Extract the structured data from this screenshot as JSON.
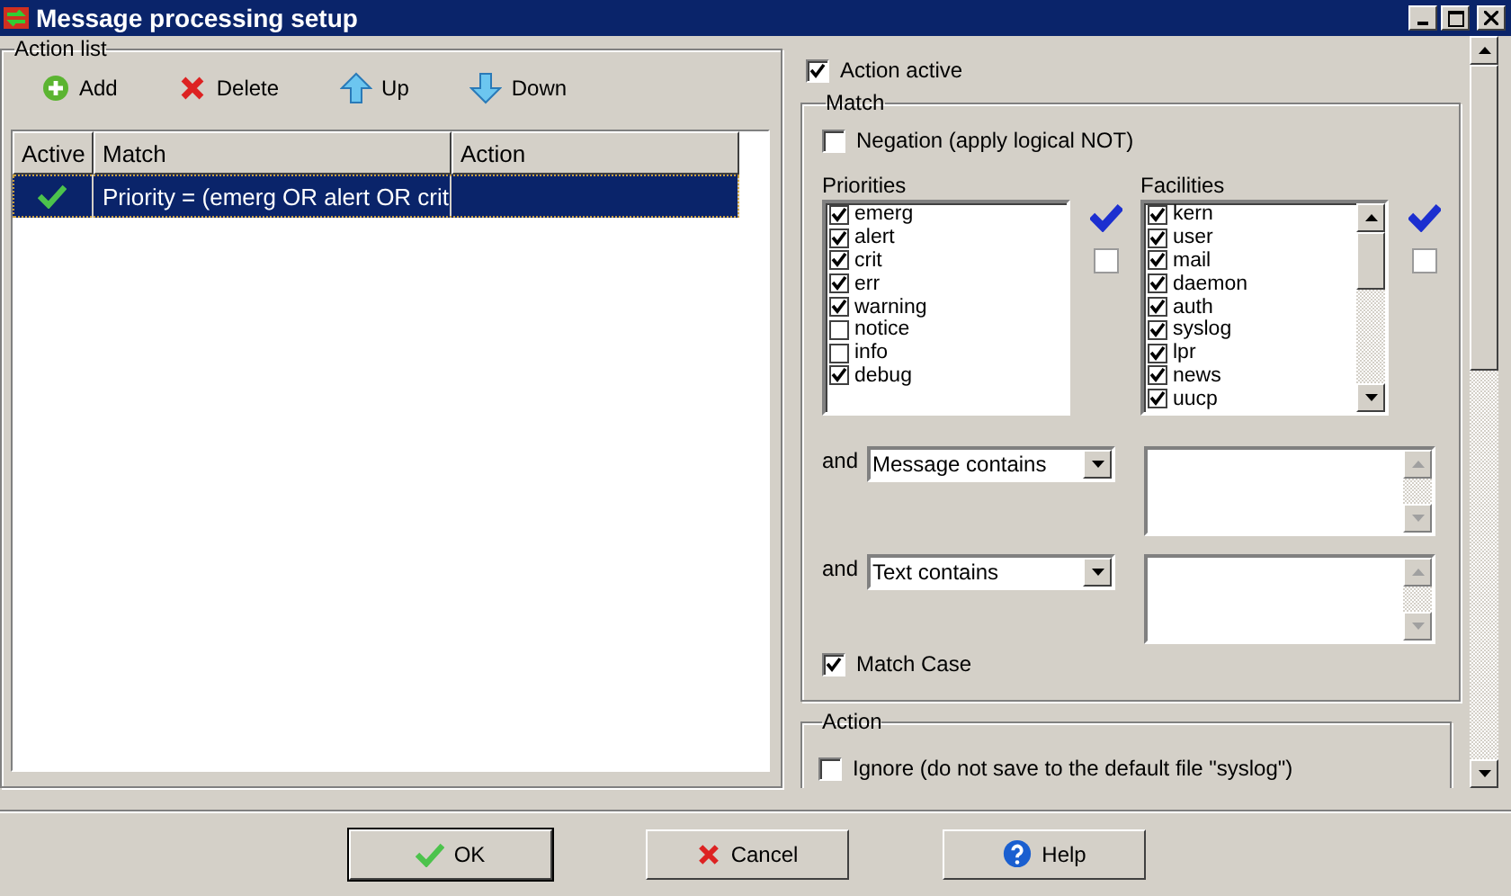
{
  "window": {
    "title": "Message processing setup"
  },
  "action_list": {
    "label": "Action list",
    "toolbar": [
      {
        "kind": "add",
        "label": "Add"
      },
      {
        "kind": "delete",
        "label": "Delete"
      },
      {
        "kind": "up",
        "label": "Up"
      },
      {
        "kind": "down",
        "label": "Down"
      }
    ],
    "columns": [
      "Active",
      "Match",
      "Action"
    ],
    "rows": [
      {
        "active": true,
        "match": "Priority = (emerg OR alert OR crit",
        "selected": true
      }
    ]
  },
  "action_active": {
    "label": "Action active",
    "checked": true
  },
  "match": {
    "label": "Match",
    "negation": {
      "label": "Negation (apply logical NOT)",
      "checked": false
    },
    "priorities": {
      "label": "Priorities",
      "items": [
        {
          "label": "emerg",
          "checked": true
        },
        {
          "label": "alert",
          "checked": true
        },
        {
          "label": "crit",
          "checked": true
        },
        {
          "label": "err",
          "checked": true
        },
        {
          "label": "warning",
          "checked": true
        },
        {
          "label": "notice",
          "checked": false
        },
        {
          "label": "info",
          "checked": false
        },
        {
          "label": "debug",
          "checked": true
        }
      ]
    },
    "facilities": {
      "label": "Facilities",
      "items": [
        {
          "label": "kern",
          "checked": true
        },
        {
          "label": "user",
          "checked": true
        },
        {
          "label": "mail",
          "checked": true
        },
        {
          "label": "daemon",
          "checked": true
        },
        {
          "label": "auth",
          "checked": true
        },
        {
          "label": "syslog",
          "checked": true
        },
        {
          "label": "lpr",
          "checked": true
        },
        {
          "label": "news",
          "checked": true
        },
        {
          "label": "uucp",
          "checked": true
        }
      ]
    },
    "conditions": [
      {
        "joiner": "and",
        "field": "Message contains"
      },
      {
        "joiner": "and",
        "field": "Text contains"
      }
    ],
    "match_case": {
      "label": "Match Case",
      "checked": true
    }
  },
  "action": {
    "label": "Action",
    "ignore": {
      "label": "Ignore (do not save to the default file \"syslog\")",
      "checked": false
    }
  },
  "buttons": [
    {
      "kind": "ok",
      "label": "OK"
    },
    {
      "kind": "cancel",
      "label": "Cancel"
    },
    {
      "kind": "help",
      "label": "Help"
    }
  ]
}
